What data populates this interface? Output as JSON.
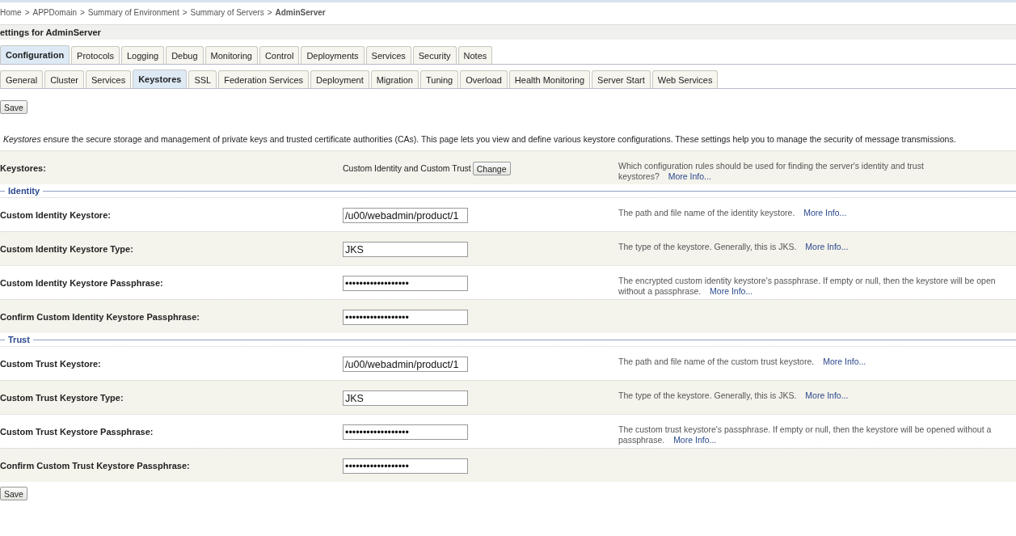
{
  "breadcrumb": {
    "separator": ">",
    "items": [
      {
        "label": "Home",
        "current": false
      },
      {
        "label": "APPDomain",
        "current": false
      },
      {
        "label": "Summary of Environment",
        "current": false
      },
      {
        "label": "Summary of Servers",
        "current": false
      },
      {
        "label": "AdminServer",
        "current": true
      }
    ]
  },
  "heading": "ettings for AdminServer",
  "tabs": [
    {
      "label": "Configuration",
      "selected": true
    },
    {
      "label": "Protocols",
      "selected": false
    },
    {
      "label": "Logging",
      "selected": false
    },
    {
      "label": "Debug",
      "selected": false
    },
    {
      "label": "Monitoring",
      "selected": false
    },
    {
      "label": "Control",
      "selected": false
    },
    {
      "label": "Deployments",
      "selected": false
    },
    {
      "label": "Services",
      "selected": false
    },
    {
      "label": "Security",
      "selected": false
    },
    {
      "label": "Notes",
      "selected": false
    }
  ],
  "subtabs": [
    {
      "label": "General",
      "selected": false
    },
    {
      "label": "Cluster",
      "selected": false
    },
    {
      "label": "Services",
      "selected": false
    },
    {
      "label": "Keystores",
      "selected": true
    },
    {
      "label": "SSL",
      "selected": false
    },
    {
      "label": "Federation Services",
      "selected": false
    },
    {
      "label": "Deployment",
      "selected": false
    },
    {
      "label": "Migration",
      "selected": false
    },
    {
      "label": "Tuning",
      "selected": false
    },
    {
      "label": "Overload",
      "selected": false
    },
    {
      "label": "Health Monitoring",
      "selected": false
    },
    {
      "label": "Server Start",
      "selected": false
    },
    {
      "label": "Web Services",
      "selected": false
    }
  ],
  "save_top": "Save",
  "intro": "*Keystores* ensure the secure storage and management of private keys and trusted certificate authorities (CAs). This page lets you view and define various keystore configurations. These settings help you to manage the security of message transmissions.",
  "keystores_row": {
    "label": "Keystores:",
    "value": "Custom Identity and Custom Trust",
    "button": "Change",
    "description": "Which configuration rules should be used for finding the server's identity and trust keystores?",
    "link": "More Info..."
  },
  "sections": [
    {
      "title": "Identity",
      "rows": [
        {
          "label": "Custom Identity Keystore:",
          "value": "/u00/webadmin/product/1",
          "description": "The path and file name of the identity keystore.",
          "link": "More Info..."
        },
        {
          "label": "Custom Identity Keystore Type:",
          "value": "JKS",
          "description": "The type of the keystore. Generally, this is JKS.",
          "link": "More Info..."
        },
        {
          "label": "Custom Identity Keystore Passphrase:",
          "value": "••••••••••••••••••",
          "description": "The encrypted custom identity keystore's passphrase. If empty or null, then the keystore will be open without a passphrase.",
          "link": "More Info..."
        },
        {
          "label": "Confirm Custom Identity Keystore Passphrase:",
          "value": "••••••••••••••••••"
        }
      ]
    },
    {
      "title": "Trust",
      "rows": [
        {
          "label": "Custom Trust Keystore:",
          "value": "/u00/webadmin/product/1",
          "description": "The path and file name of the custom trust keystore.",
          "link": "More Info..."
        },
        {
          "label": "Custom Trust Keystore Type:",
          "value": "JKS",
          "description": "The type of the keystore. Generally, this is JKS.",
          "link": "More Info..."
        },
        {
          "label": "Custom Trust Keystore Passphrase:",
          "value": "••••••••••••••••••",
          "description": "The custom trust keystore's passphrase. If empty or null, then the keystore will be opened without a passphrase.",
          "link": "More Info..."
        },
        {
          "label": "Confirm Custom Trust Keystore Passphrase:",
          "value": "••••••••••••••••••"
        }
      ]
    }
  ],
  "save_bottom": "Save"
}
